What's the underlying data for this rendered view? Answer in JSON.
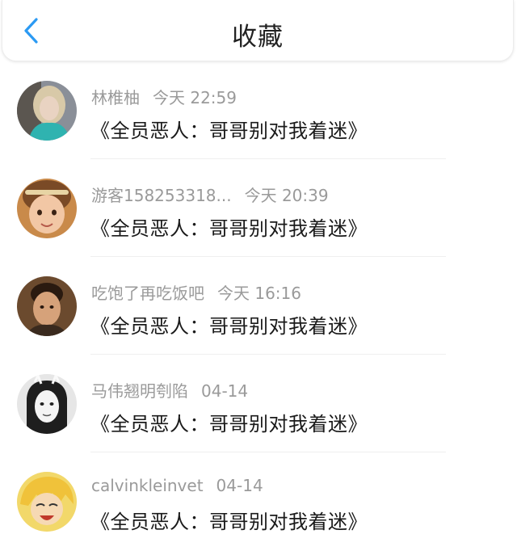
{
  "header": {
    "title": "收藏",
    "back_icon": "chevron-left-icon",
    "accent_color": "#2b9af3"
  },
  "favorites": [
    {
      "name": "林椎柚",
      "time": "今天 22:59",
      "content": "《全员恶人：哥哥别对我着迷》"
    },
    {
      "name": "游客158253318...",
      "time": "今天 20:39",
      "content": "《全员恶人：哥哥别对我着迷》"
    },
    {
      "name": "吃饱了再吃饭吧",
      "time": "今天 16:16",
      "content": "《全员恶人：哥哥别对我着迷》"
    },
    {
      "name": "马伟翘明刳陷",
      "time": "04-14",
      "content": "《全员恶人：哥哥别对我着迷》"
    },
    {
      "name": "calvinkleinvet",
      "time": "04-14",
      "content": "《全员恶人：哥哥别对我着迷》"
    }
  ]
}
